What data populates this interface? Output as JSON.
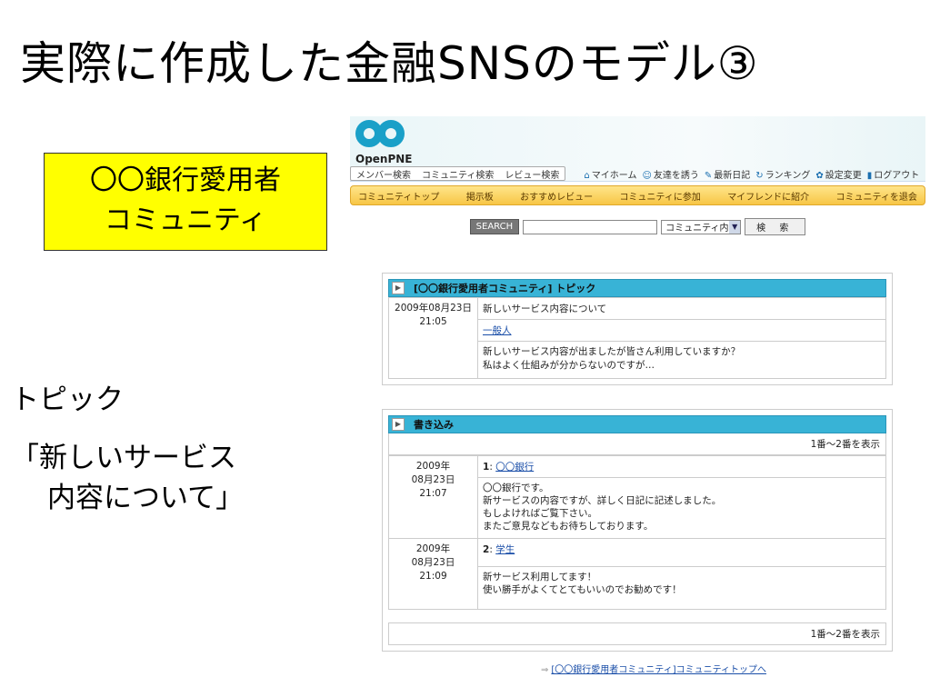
{
  "slide": {
    "title": "実際に作成した金融SNSのモデル③",
    "box_line1": "〇〇銀行愛用者",
    "box_line2": "コミュニティ",
    "label1": "トピック",
    "label2": "「新しいサービス",
    "label3": "内容について」"
  },
  "app": {
    "logo": "OpenPNE",
    "search_tabs": [
      "メンバー検索",
      "コミュニティ検索",
      "レビュー検索"
    ],
    "top_nav": [
      "マイホーム",
      "友達を誘う",
      "最新日記",
      "ランキング",
      "設定変更",
      "ログアウト"
    ],
    "menu": [
      "コミュニティトップ",
      "掲示板",
      "おすすめレビュー",
      "コミュニティに参加",
      "マイフレンドに紹介",
      "コミュニティを退会"
    ],
    "search_button": "SEARCH",
    "search_value": "",
    "search_scope": "コミュニティ内",
    "search_go": "検 索"
  },
  "topic": {
    "header": "[〇〇銀行愛用者コミュニティ] トピック",
    "date": "2009年08月23日",
    "time": "21:05",
    "title": "新しいサービス内容について",
    "author": "一般人",
    "body1": "新しいサービス内容が出ましたが皆さん利用していますか？",
    "body2": "私はよく仕組みが分からないのですが…"
  },
  "posts": {
    "header": "書き込み",
    "range": "1番～2番を表示",
    "items": [
      {
        "year": "2009年",
        "md": "08月23日",
        "time": "21:07",
        "num": "1",
        "author": "〇〇銀行",
        "l1": "〇〇銀行です。",
        "l2": "新サービスの内容ですが、詳しく日記に記述しました。",
        "l3": "もしよければご覧下さい。",
        "l4": "またご意見などもお待ちしております。"
      },
      {
        "year": "2009年",
        "md": "08月23日",
        "time": "21:09",
        "num": "2",
        "author": "学生",
        "l1": "新サービス利用してます！",
        "l2": "使い勝手がよくてとてもいいのでお勧めです！"
      }
    ]
  },
  "footer_link": "[〇〇銀行愛用者コミュニティ]コミュニティトップへ"
}
